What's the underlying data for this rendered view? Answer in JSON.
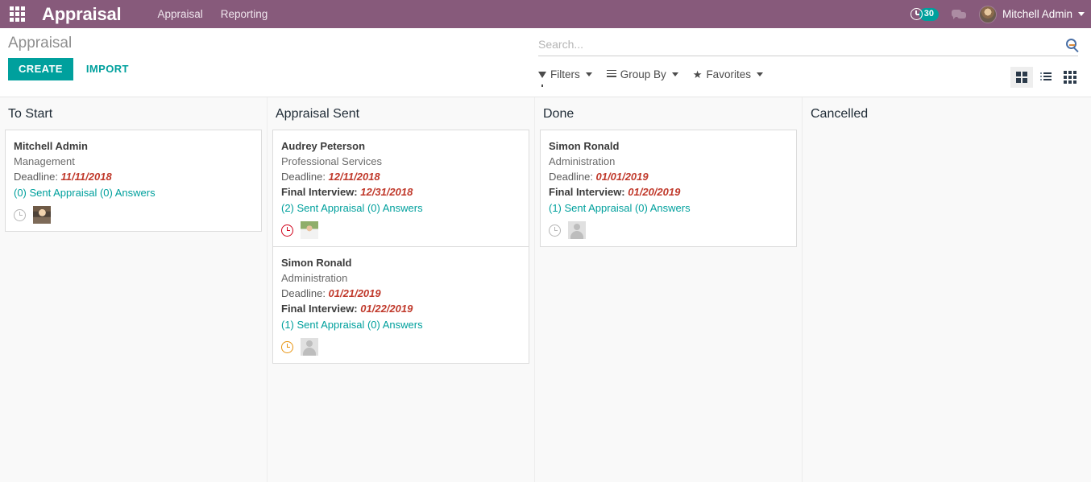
{
  "navbar": {
    "apps_icon": "apps-grid-icon",
    "brand": "Appraisal",
    "links": [
      {
        "label": "Appraisal"
      },
      {
        "label": "Reporting"
      }
    ],
    "activity": {
      "icon": "clock-icon",
      "badge": "30"
    },
    "messages": {
      "icon": "chat-bubbles-icon"
    },
    "user": {
      "name": "Mitchell Admin",
      "avatar": "user-avatar",
      "caret": "chevron-down-icon"
    },
    "accent_color": "#875A7B"
  },
  "control_panel": {
    "breadcrumb": "Appraisal",
    "create_label": "CREATE",
    "import_label": "IMPORT",
    "create_color": "#00A09D",
    "search": {
      "placeholder": "Search...",
      "value": "",
      "icon": "magnifier-icon"
    },
    "filters": [
      {
        "label": "Filters",
        "icon": "funnel-icon"
      },
      {
        "label": "Group By",
        "icon": "hamburger-lines-icon"
      },
      {
        "label": "Favorites",
        "icon": "star-icon"
      }
    ],
    "views": [
      {
        "name": "kanban",
        "icon": "kanban-icon",
        "active": true
      },
      {
        "name": "list",
        "icon": "list-icon",
        "active": false
      },
      {
        "name": "pivot",
        "icon": "pivot-icon",
        "active": false
      }
    ]
  },
  "kanban": {
    "columns": [
      {
        "title": "To Start",
        "cards": [
          {
            "name": "Mitchell Admin",
            "department": "Management",
            "deadline_label": "Deadline:",
            "deadline": "11/11/2018",
            "has_final_interview": false,
            "final_interview_label": "",
            "final_interview": "",
            "links": "(0) Sent Appraisal (0) Answers",
            "activity_state": "gray",
            "avatar": "photo-m"
          }
        ]
      },
      {
        "title": "Appraisal Sent",
        "cards": [
          {
            "name": "Audrey Peterson",
            "department": "Professional Services",
            "deadline_label": "Deadline:",
            "deadline": "12/11/2018",
            "has_final_interview": true,
            "final_interview_label": "Final Interview:",
            "final_interview": "12/31/2018",
            "links": "(2) Sent Appraisal (0) Answers",
            "activity_state": "red",
            "avatar": "photo-f"
          },
          {
            "name": "Simon Ronald",
            "department": "Administration",
            "deadline_label": "Deadline:",
            "deadline": "01/21/2019",
            "has_final_interview": true,
            "final_interview_label": "Final Interview:",
            "final_interview": "01/22/2019",
            "links": "(1) Sent Appraisal (0) Answers",
            "activity_state": "orange",
            "avatar": "silhouette"
          }
        ]
      },
      {
        "title": "Done",
        "cards": [
          {
            "name": "Simon Ronald",
            "department": "Administration",
            "deadline_label": "Deadline:",
            "deadline": "01/01/2019",
            "has_final_interview": true,
            "final_interview_label": "Final Interview:",
            "final_interview": "01/20/2019",
            "links": "(1) Sent Appraisal (0) Answers",
            "activity_state": "gray",
            "avatar": "silhouette"
          }
        ]
      },
      {
        "title": "Cancelled",
        "cards": []
      }
    ]
  }
}
